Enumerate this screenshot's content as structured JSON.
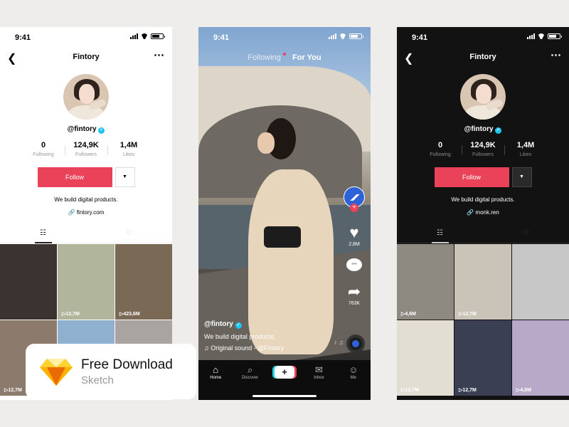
{
  "profile_light": {
    "time": "9:41",
    "title": "Fintory",
    "handle": "@fintory",
    "stats": [
      {
        "value": "0",
        "label": "Following"
      },
      {
        "value": "124,9K",
        "label": "Followers"
      },
      {
        "value": "1,4M",
        "label": "Likes"
      }
    ],
    "follow_label": "Follow",
    "bio": "We build digital products.",
    "link": "fintory.com",
    "tiles": [
      {
        "views": "",
        "color": "#3a3330"
      },
      {
        "views": "12,7M",
        "color": "#b0b59c"
      },
      {
        "views": "423,6M",
        "color": "#7a6a55"
      },
      {
        "views": "12,7M",
        "color": "#8c7a6c"
      },
      {
        "views": "",
        "color": "#8fb1cf"
      },
      {
        "views": "",
        "color": "#a9a4a0"
      }
    ]
  },
  "feed": {
    "time": "9:41",
    "tab_following": "Following",
    "tab_foryou": "For You",
    "like_count": "2,8M",
    "share_count": "763K",
    "caption_handle": "@fintory",
    "caption_text": "We build digital products.",
    "sound": "Original sound - @Fintory",
    "nav": [
      {
        "label": "Home",
        "icon": "home-icon",
        "glyph": "⌂"
      },
      {
        "label": "Discover",
        "icon": "discover-icon",
        "glyph": "⌕"
      },
      {
        "label": "",
        "icon": "create-icon",
        "glyph": "+"
      },
      {
        "label": "Inbox",
        "icon": "inbox-icon",
        "glyph": "✉"
      },
      {
        "label": "Me",
        "icon": "me-icon",
        "glyph": "☺"
      }
    ]
  },
  "profile_dark": {
    "time": "9:41",
    "title": "Fintory",
    "handle": "@fintory",
    "stats": [
      {
        "value": "0",
        "label": "Following"
      },
      {
        "value": "124,9K",
        "label": "Followers"
      },
      {
        "value": "1,4M",
        "label": "Likes"
      }
    ],
    "follow_label": "Follow",
    "bio": "We build digital products.",
    "link": "monk.ren",
    "tiles": [
      {
        "views": "4,6M",
        "color": "#8e8a82"
      },
      {
        "views": "12,7M",
        "color": "#c9c3b8"
      },
      {
        "views": "",
        "color": "#c7c7c7"
      },
      {
        "views": "12,7M",
        "color": "#e3ded4"
      },
      {
        "views": "12,7M",
        "color": "#3a3f54"
      },
      {
        "views": "4,6M",
        "color": "#b7a9c7"
      }
    ]
  },
  "badge": {
    "title": "Free Download",
    "subtitle": "Sketch"
  },
  "colors": {
    "accent": "#ea4359",
    "verified": "#20c4f4",
    "sketch_top": "#fdd231",
    "sketch_mid": "#fcb300",
    "sketch_bottom": "#ea6c00"
  }
}
